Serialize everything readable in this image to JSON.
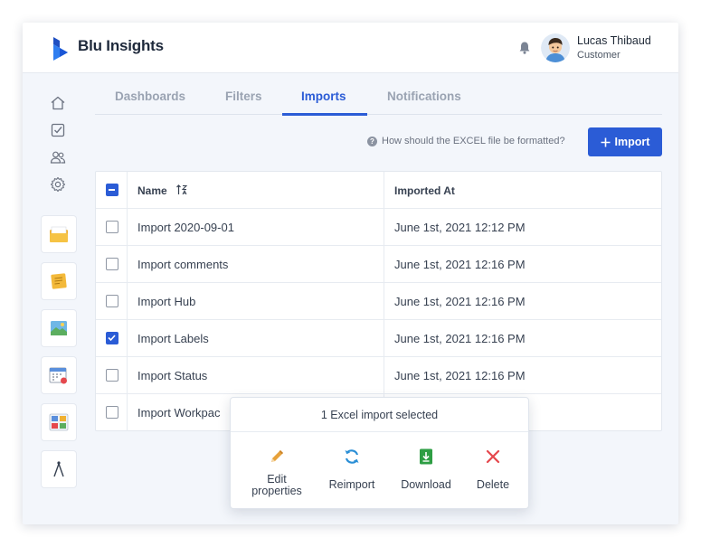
{
  "app": {
    "title": "Blu Insights"
  },
  "user": {
    "name": "Lucas Thibaud",
    "role": "Customer"
  },
  "tabs": [
    {
      "label": "Dashboards",
      "active": false
    },
    {
      "label": "Filters",
      "active": false
    },
    {
      "label": "Imports",
      "active": true
    },
    {
      "label": "Notifications",
      "active": false
    }
  ],
  "toolbar": {
    "help_text": "How should the EXCEL file be formatted?",
    "import_label": "Import"
  },
  "table": {
    "columns": [
      "Name",
      "Imported At"
    ],
    "rows": [
      {
        "name": "Import 2020-09-01",
        "imported_at": "June 1st, 2021 12:12 PM",
        "checked": false
      },
      {
        "name": "Import comments",
        "imported_at": "June 1st, 2021 12:16 PM",
        "checked": false
      },
      {
        "name": "Import Hub",
        "imported_at": "June 1st, 2021 12:16 PM",
        "checked": false
      },
      {
        "name": "Import Labels",
        "imported_at": "June 1st, 2021 12:16 PM",
        "checked": true
      },
      {
        "name": "Import Status",
        "imported_at": "June 1st, 2021 12:16 PM",
        "checked": false
      },
      {
        "name": "Import Workpac",
        "imported_at": "",
        "checked": false
      }
    ]
  },
  "selection_popover": {
    "title": "1 Excel import selected",
    "actions": [
      {
        "label": "Edit\nproperties",
        "icon": "pencil-icon"
      },
      {
        "label": "Reimport",
        "icon": "refresh-icon"
      },
      {
        "label": "Download",
        "icon": "download-icon"
      },
      {
        "label": "Delete",
        "icon": "close-icon"
      }
    ]
  },
  "colors": {
    "primary": "#2b5cd6",
    "delete": "#e5484d",
    "download": "#2e9e44",
    "edit": "#e7a23b"
  }
}
